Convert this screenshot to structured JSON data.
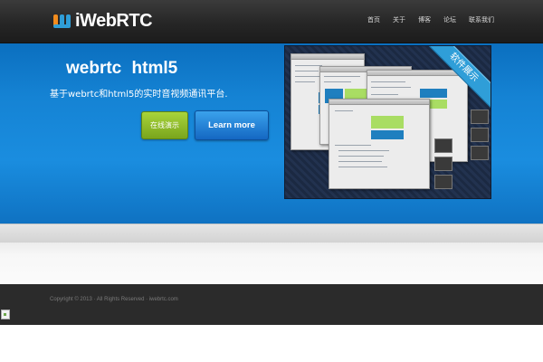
{
  "header": {
    "logo_text": "iWebRTC",
    "nav": [
      "首页",
      "关于",
      "博客",
      "论坛",
      "联系我们"
    ]
  },
  "hero": {
    "title": "webrtc  html5",
    "subtitle": "基于webrtc和html5的实时音视频通讯平台.",
    "demo_button": "在线演示",
    "learn_button": "Learn more",
    "screenshot_ribbon": "软件展示"
  },
  "footer": {
    "copyright": "Copyright © 2013 · All Rights Reserved · iwebrtc.com"
  },
  "colors": {
    "hero_blue": "#1a8ddf",
    "demo_green": "#8cbd26",
    "learn_blue": "#1f7fd0"
  }
}
